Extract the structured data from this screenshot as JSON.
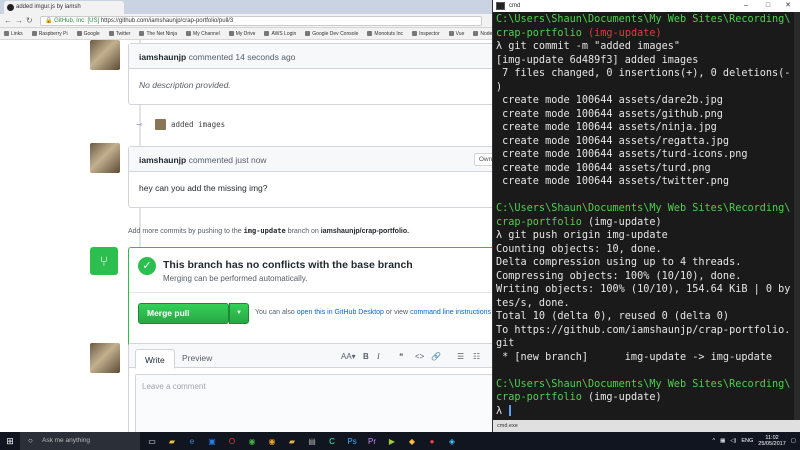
{
  "browser": {
    "tab_title": "added imgur.js by iamsh",
    "address": {
      "org": "GitHub, Inc. [US]",
      "url": "https://github.com/iamshaunjp/crap-portfolio/pull/3"
    },
    "bookmarks": [
      "Links",
      "Raspberry Pi",
      "Google",
      "Twitter",
      "The Net Ninja",
      "My Channel",
      "My Drive",
      "AWS Login",
      "Google Dev Console",
      "Monotuts Inc",
      "Inspector",
      "Vue",
      "Node"
    ]
  },
  "page": {
    "comment1": {
      "user": "iamshaunjp",
      "action": "commented 14 seconds ago",
      "body": "No description provided."
    },
    "commit": {
      "message": "added images"
    },
    "comment2": {
      "user": "iamshaunjp",
      "action": "commented just now",
      "badge": "Owner",
      "body": "hey can you add the missing img?"
    },
    "push_hint": {
      "prefix": "Add more commits by pushing to the",
      "branch": "img-update",
      "mid": "branch on",
      "repo": "iamshaunjp/crap-portfolio."
    },
    "merge": {
      "title": "This branch has no conflicts with the base branch",
      "subtitle": "Merging can be performed automatically.",
      "button": "Merge pull request",
      "alt_prefix": "You can also",
      "alt_link1": "open this in GitHub Desktop",
      "alt_mid": "or view",
      "alt_link2": "command line instructions"
    },
    "editor": {
      "tab_write": "Write",
      "tab_preview": "Preview",
      "placeholder": "Leave a comment",
      "tools": [
        "AA▾",
        "B",
        "I",
        "❝",
        "<>",
        "🔗",
        "☰",
        "☷"
      ]
    }
  },
  "terminal": {
    "title": "cmd",
    "footer": "cmd.exe",
    "lines": [
      {
        "c": "g",
        "t": "C:\\Users\\Shaun\\Documents\\My Web Sites\\Recording\\"
      },
      {
        "c": "g",
        "t": "crap-portfolio ",
        "r": "(img-update)"
      },
      {
        "c": "w",
        "t": "λ git commit -m \"added images\""
      },
      {
        "c": "w",
        "t": "[img-update 6d489f3] added images"
      },
      {
        "c": "w",
        "t": " 7 files changed, 0 insertions(+), 0 deletions(-"
      },
      {
        "c": "w",
        "t": ")"
      },
      {
        "c": "w",
        "t": " create mode 100644 assets/dare2b.jpg"
      },
      {
        "c": "w",
        "t": " create mode 100644 assets/github.png"
      },
      {
        "c": "w",
        "t": " create mode 100644 assets/ninja.jpg"
      },
      {
        "c": "w",
        "t": " create mode 100644 assets/regatta.jpg"
      },
      {
        "c": "w",
        "t": " create mode 100644 assets/turd-icons.png"
      },
      {
        "c": "w",
        "t": " create mode 100644 assets/turd.png"
      },
      {
        "c": "w",
        "t": " create mode 100644 assets/twitter.png"
      },
      {
        "c": "w",
        "t": ""
      },
      {
        "c": "g",
        "t": "C:\\Users\\Shaun\\Documents\\My Web Sites\\Recording\\"
      },
      {
        "c": "g",
        "t": "crap-portfolio ",
        "w2": "(img-update)"
      },
      {
        "c": "w",
        "t": "λ git push origin img-update"
      },
      {
        "c": "w",
        "t": "Counting objects: 10, done."
      },
      {
        "c": "w",
        "t": "Delta compression using up to 4 threads."
      },
      {
        "c": "w",
        "t": "Compressing objects: 100% (10/10), done."
      },
      {
        "c": "w",
        "t": "Writing objects: 100% (10/10), 154.64 KiB | 0 by"
      },
      {
        "c": "w",
        "t": "tes/s, done."
      },
      {
        "c": "w",
        "t": "Total 10 (delta 0), reused 0 (delta 0)"
      },
      {
        "c": "w",
        "t": "To https://github.com/iamshaunjp/crap-portfolio."
      },
      {
        "c": "w",
        "t": "git"
      },
      {
        "c": "w",
        "t": " * [new branch]      img-update -> img-update"
      },
      {
        "c": "w",
        "t": ""
      },
      {
        "c": "g",
        "t": "C:\\Users\\Shaun\\Documents\\My Web Sites\\Recording\\"
      },
      {
        "c": "g",
        "t": "crap-portfolio ",
        "w2": "(img-update)"
      },
      {
        "c": "w",
        "t": "λ "
      }
    ]
  },
  "taskbar": {
    "search": "Ask me anything",
    "lang": "ENG",
    "time": "11:02",
    "date": "25/05/2017"
  }
}
